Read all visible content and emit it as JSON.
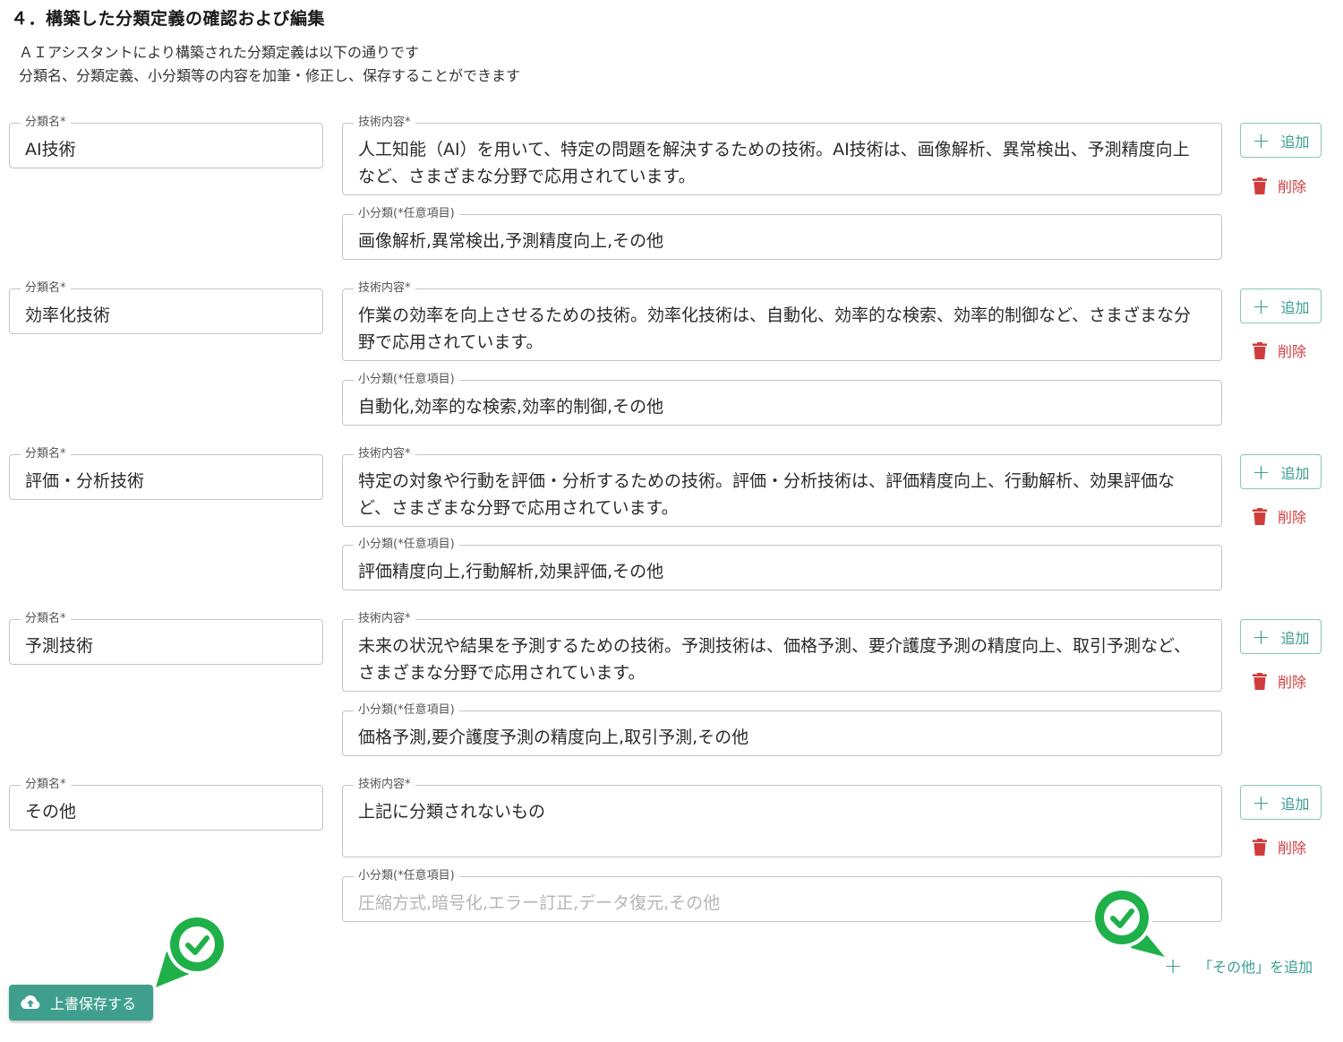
{
  "page": {
    "title": "４．構築した分類定義の確認および編集",
    "intro_line1": "ＡＩアシスタントにより構築された分類定義は以下の通りです",
    "intro_line2": "分類名、分類定義、小分類等の内容を加筆・修正し、保存することができます"
  },
  "labels": {
    "name": "分類名*",
    "description": "技術内容*",
    "subcategory": "小分類(*任意項目)",
    "add": "追加",
    "delete": "削除",
    "add_other": "「その他」を追加",
    "save": "上書保存する"
  },
  "categories": [
    {
      "name": "AI技術",
      "description": "人工知能（AI）を用いて、特定の問題を解決するための技術。AI技術は、画像解析、異常検出、予測精度向上など、さまざまな分野で応用されています。",
      "subcategories": "画像解析,異常検出,予測精度向上,その他"
    },
    {
      "name": "効率化技術",
      "description": "作業の効率を向上させるための技術。効率化技術は、自動化、効率的な検索、効率的制御など、さまざまな分野で応用されています。",
      "subcategories": "自動化,効率的な検索,効率的制御,その他"
    },
    {
      "name": "評価・分析技術",
      "description": "特定の対象や行動を評価・分析するための技術。評価・分析技術は、評価精度向上、行動解析、効果評価など、さまざまな分野で応用されています。",
      "subcategories": "評価精度向上,行動解析,効果評価,その他"
    },
    {
      "name": "予測技術",
      "description": "未来の状況や結果を予測するための技術。予測技術は、価格予測、要介護度予測の精度向上、取引予測など、さまざまな分野で応用されています。",
      "subcategories": "価格予測,要介護度予測の精度向上,取引予測,その他"
    },
    {
      "name": "その他",
      "description": "上記に分類されないもの",
      "subcategories_placeholder": "圧縮方式,暗号化,エラー訂正,データ復元,その他"
    }
  ],
  "icons": {
    "add": "plus-icon",
    "delete": "trash-icon",
    "save": "cloud-upload-icon",
    "badge": "check-circle-icon"
  },
  "colors": {
    "accent": "#3f9f8f",
    "delete": "#d23b3b",
    "badge": "#1fb04a"
  }
}
